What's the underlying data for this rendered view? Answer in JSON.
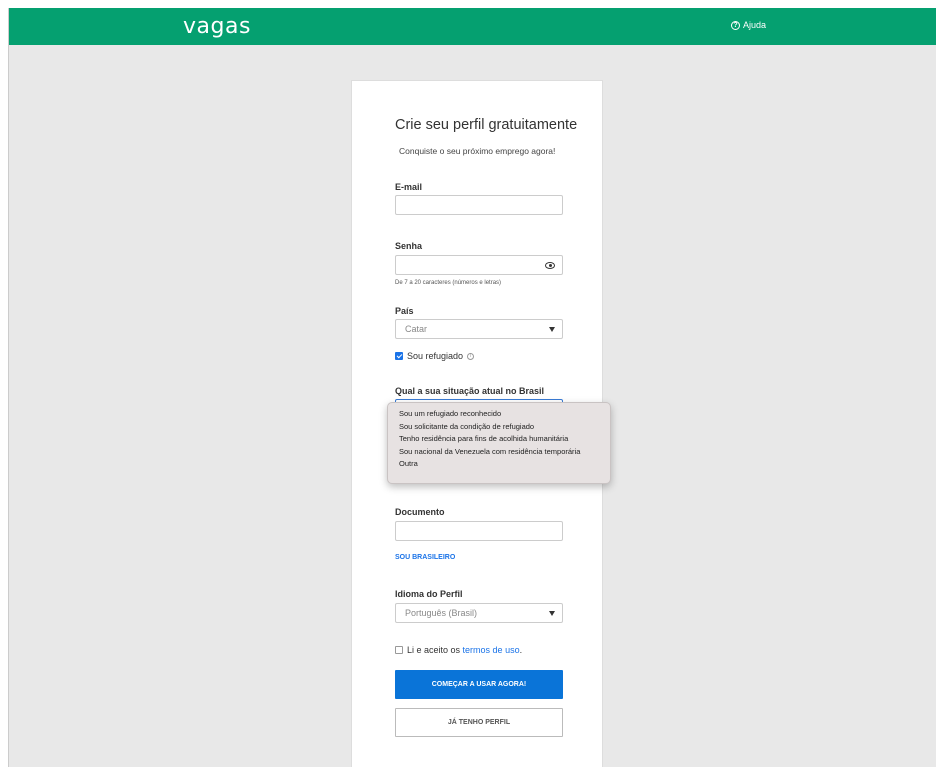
{
  "header": {
    "logo": "vagas",
    "help_label": "Ajuda",
    "help_icon": "question-circle-icon",
    "brand_color": "#05a070"
  },
  "form": {
    "title": "Crie seu perfil gratuitamente",
    "subtitle": "Conquiste o seu próximo emprego agora!",
    "email_label": "E-mail",
    "email_value": "",
    "password_label": "Senha",
    "password_value": "",
    "password_hint": "De 7 a 20 caracteres (números e letras)",
    "country_label": "País",
    "country_value": "Catar",
    "refugee_label": "Sou refugiado",
    "refugee_checked": true,
    "situation_label": "Qual a sua situação atual no Brasil",
    "document_label": "Documento",
    "document_value": "",
    "brazilian_link": "SOU BRASILEIRO",
    "language_label": "Idioma do Perfil",
    "language_value": "Português (Brasil)",
    "terms_prefix": "Li e aceito os ",
    "terms_link": "termos de uso",
    "terms_suffix": ".",
    "terms_checked": false,
    "primary_button": "COMEÇAR A USAR AGORA!",
    "secondary_button": "JÁ TENHO PERFIL",
    "accent_color": "#0a74d8"
  },
  "situation_dropdown": {
    "options": [
      "Sou um refugiado reconhecido",
      "Sou solicitante da condição de refugiado",
      "Tenho residência para fins de acolhida humanitária",
      "Sou nacional da Venezuela com residência temporária",
      "Outra"
    ]
  }
}
